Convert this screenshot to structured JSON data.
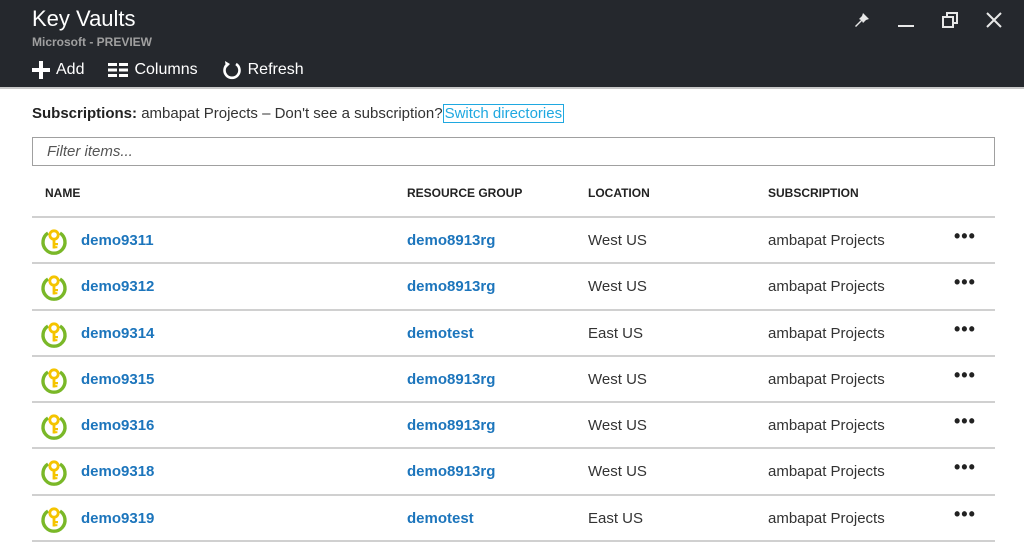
{
  "header": {
    "title": "Key Vaults",
    "subtitle": "Microsoft - PREVIEW",
    "toolbar": [
      {
        "label": "Add",
        "icon": "plus-icon"
      },
      {
        "label": "Columns",
        "icon": "columns-icon"
      },
      {
        "label": "Refresh",
        "icon": "refresh-icon"
      }
    ],
    "window_controls": [
      "pin-icon",
      "minimize-icon",
      "restore-icon",
      "close-icon"
    ]
  },
  "subscriptions": {
    "label": "Subscriptions:",
    "value": "ambapat Projects – Don't see a subscription?",
    "link": "Switch directories"
  },
  "filter": {
    "placeholder": "Filter items...",
    "value": ""
  },
  "table": {
    "columns": [
      "NAME",
      "RESOURCE GROUP",
      "LOCATION",
      "SUBSCRIPTION"
    ],
    "rows": [
      {
        "name": "demo9311",
        "resource_group": "demo8913rg",
        "location": "West US",
        "subscription": "ambapat Projects",
        "more": "•••"
      },
      {
        "name": "demo9312",
        "resource_group": "demo8913rg",
        "location": "West US",
        "subscription": "ambapat Projects",
        "more": "•••"
      },
      {
        "name": "demo9314",
        "resource_group": "demotest",
        "location": "East US",
        "subscription": "ambapat Projects",
        "more": "•••"
      },
      {
        "name": "demo9315",
        "resource_group": "demo8913rg",
        "location": "West US",
        "subscription": "ambapat Projects",
        "more": "•••"
      },
      {
        "name": "demo9316",
        "resource_group": "demo8913rg",
        "location": "West US",
        "subscription": "ambapat Projects",
        "more": "•••"
      },
      {
        "name": "demo9318",
        "resource_group": "demo8913rg",
        "location": "West US",
        "subscription": "ambapat Projects",
        "more": "•••"
      },
      {
        "name": "demo9319",
        "resource_group": "demotest",
        "location": "East US",
        "subscription": "ambapat Projects",
        "more": "•••"
      }
    ]
  }
}
